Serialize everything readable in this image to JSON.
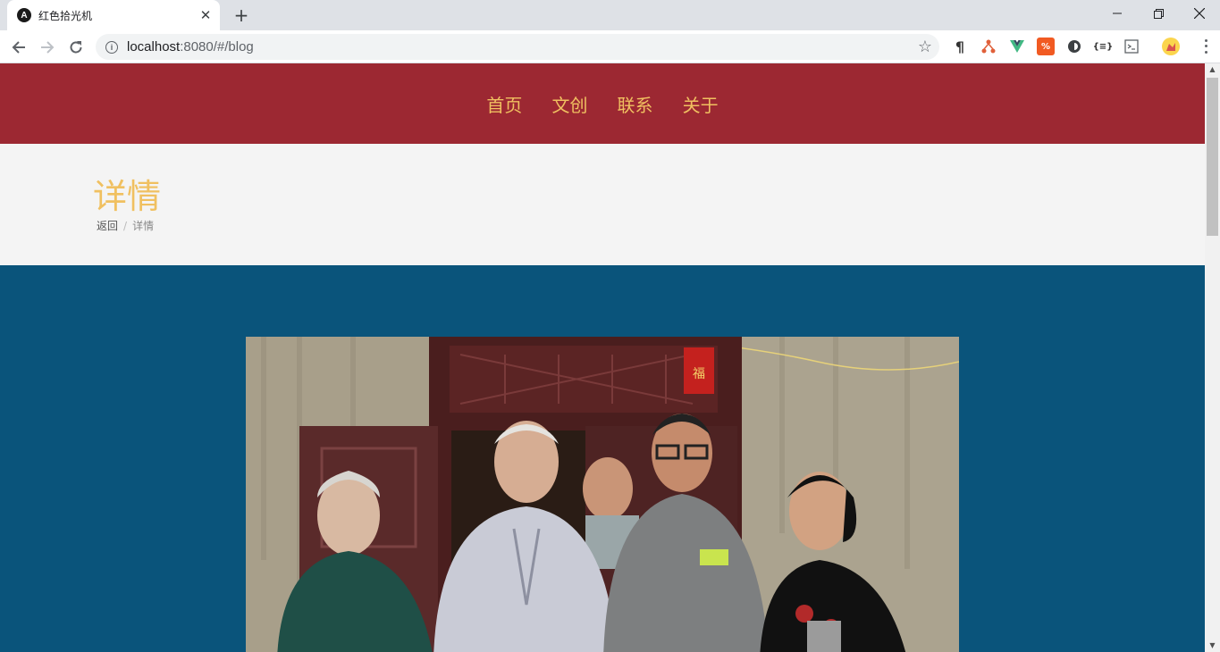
{
  "browser": {
    "tab_title": "红色拾光机",
    "tab_favicon_letter": "A",
    "url_host": "localhost",
    "url_path": ":8080/#/blog"
  },
  "site": {
    "nav": [
      "首页",
      "文创",
      "联系",
      "关于"
    ],
    "banner_title": "详情",
    "breadcrumb": {
      "back": "返回",
      "separator": "/",
      "current": "详情"
    },
    "colors": {
      "header_bg": "#9c2832",
      "nav_text": "#f0c060",
      "banner_bg": "#f4f4f4",
      "content_bg": "#0a547b"
    }
  },
  "icons": [
    "back-arrow-icon",
    "forward-arrow-icon",
    "reload-icon",
    "info-icon",
    "star-icon",
    "new-tab-icon",
    "close-icon",
    "minimize-icon",
    "maximize-icon",
    "window-close-icon",
    "kebab-menu-icon"
  ]
}
